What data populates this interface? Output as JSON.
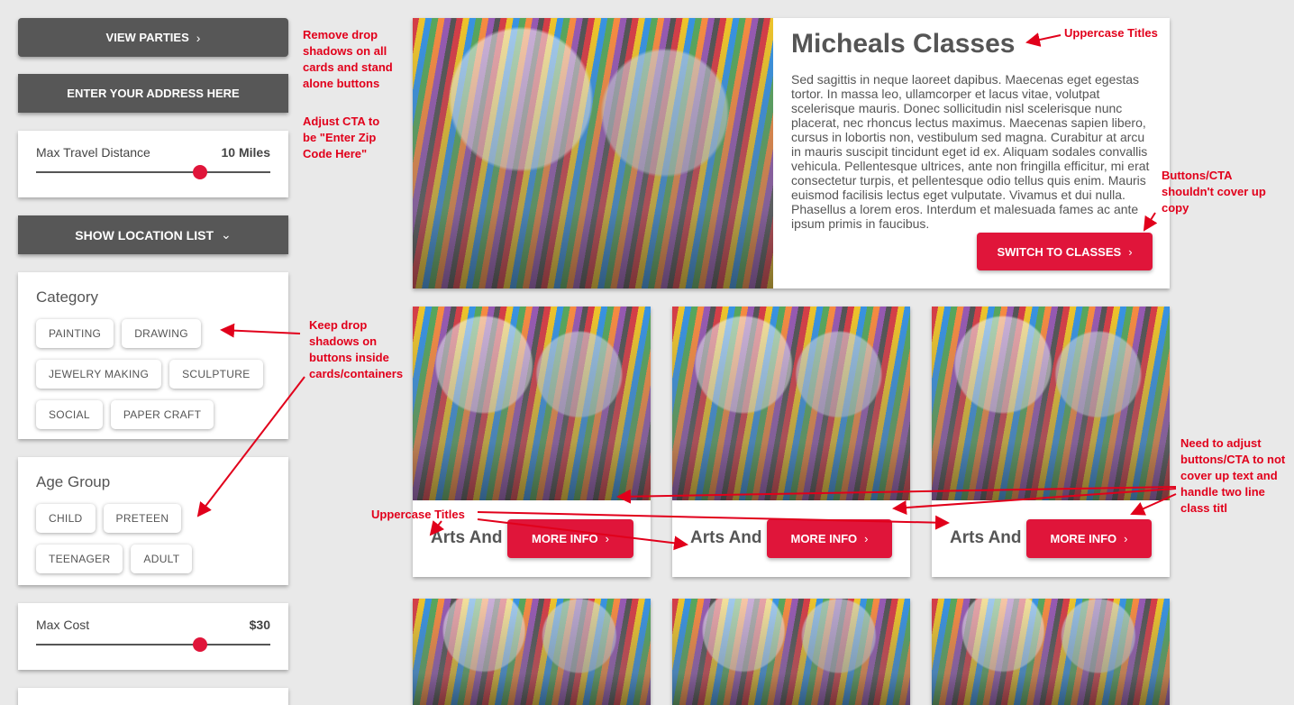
{
  "sidebar": {
    "view_parties": "VIEW PARTIES",
    "enter_address": "ENTER YOUR ADDRESS HERE",
    "travel": {
      "label": "Max Travel Distance",
      "value": "10 Miles",
      "level": 0.7
    },
    "show_location": "SHOW LOCATION LIST",
    "category": {
      "title": "Category",
      "items": [
        "PAINTING",
        "DRAWING",
        "JEWELRY MAKING",
        "SCULPTURE",
        "SOCIAL",
        "PAPER CRAFT"
      ]
    },
    "age_group": {
      "title": "Age Group",
      "items": [
        "CHILD",
        "PRETEEN",
        "TEENAGER",
        "ADULT"
      ]
    },
    "cost": {
      "label": "Max Cost",
      "value": "$30",
      "level": 0.7
    }
  },
  "hero": {
    "title": "Micheals Classes",
    "body": "Sed sagittis in neque laoreet dapibus. Maecenas eget egestas tortor. In massa leo, ullamcorper et lacus vitae, volutpat scelerisque mauris. Donec sollicitudin nisl scelerisque nunc placerat, nec rhoncus lectus maximus. Maecenas sapien libero, cursus in lobortis non, vestibulum sed magna. Curabitur at arcu in mauris suscipit tincidunt eget id ex. Aliquam sodales convallis vehicula. Pellentesque ultrices, ante non fringilla efficitur, mi erat consectetur turpis, et pellentesque odio tellus quis enim. Mauris euismod facilisis lectus eget vulputate. Vivamus et dui nulla. Phasellus a lorem eros. Interdum et malesuada fames ac ante ipsum primis in faucibus.",
    "cta": "SWITCH TO CLASSES"
  },
  "cards": [
    {
      "title": "Arts And",
      "cta": "MORE INFO"
    },
    {
      "title": "Arts And",
      "cta": "MORE INFO"
    },
    {
      "title": "Arts And",
      "cta": "MORE INFO"
    }
  ],
  "annotations": {
    "remove_shadows": "Remove drop shadows on all cards and stand alone buttons",
    "adjust_cta": "Adjust CTA to be \"Enter Zip Code Here\"",
    "uppercase_hero": "Uppercase Titles",
    "buttons_cover": "Buttons/CTA shouldn't cover up copy",
    "keep_shadows": "Keep drop shadows on buttons inside cards/containers",
    "uppercase_cards": "Uppercase Titles",
    "need_adjust": "Need to adjust buttons/CTA to not cover up text and handle two line class titl"
  },
  "colors": {
    "accent": "#e0153a",
    "dark_button": "#575757",
    "annotation": "#e1001b",
    "background": "#e9e9e9"
  }
}
